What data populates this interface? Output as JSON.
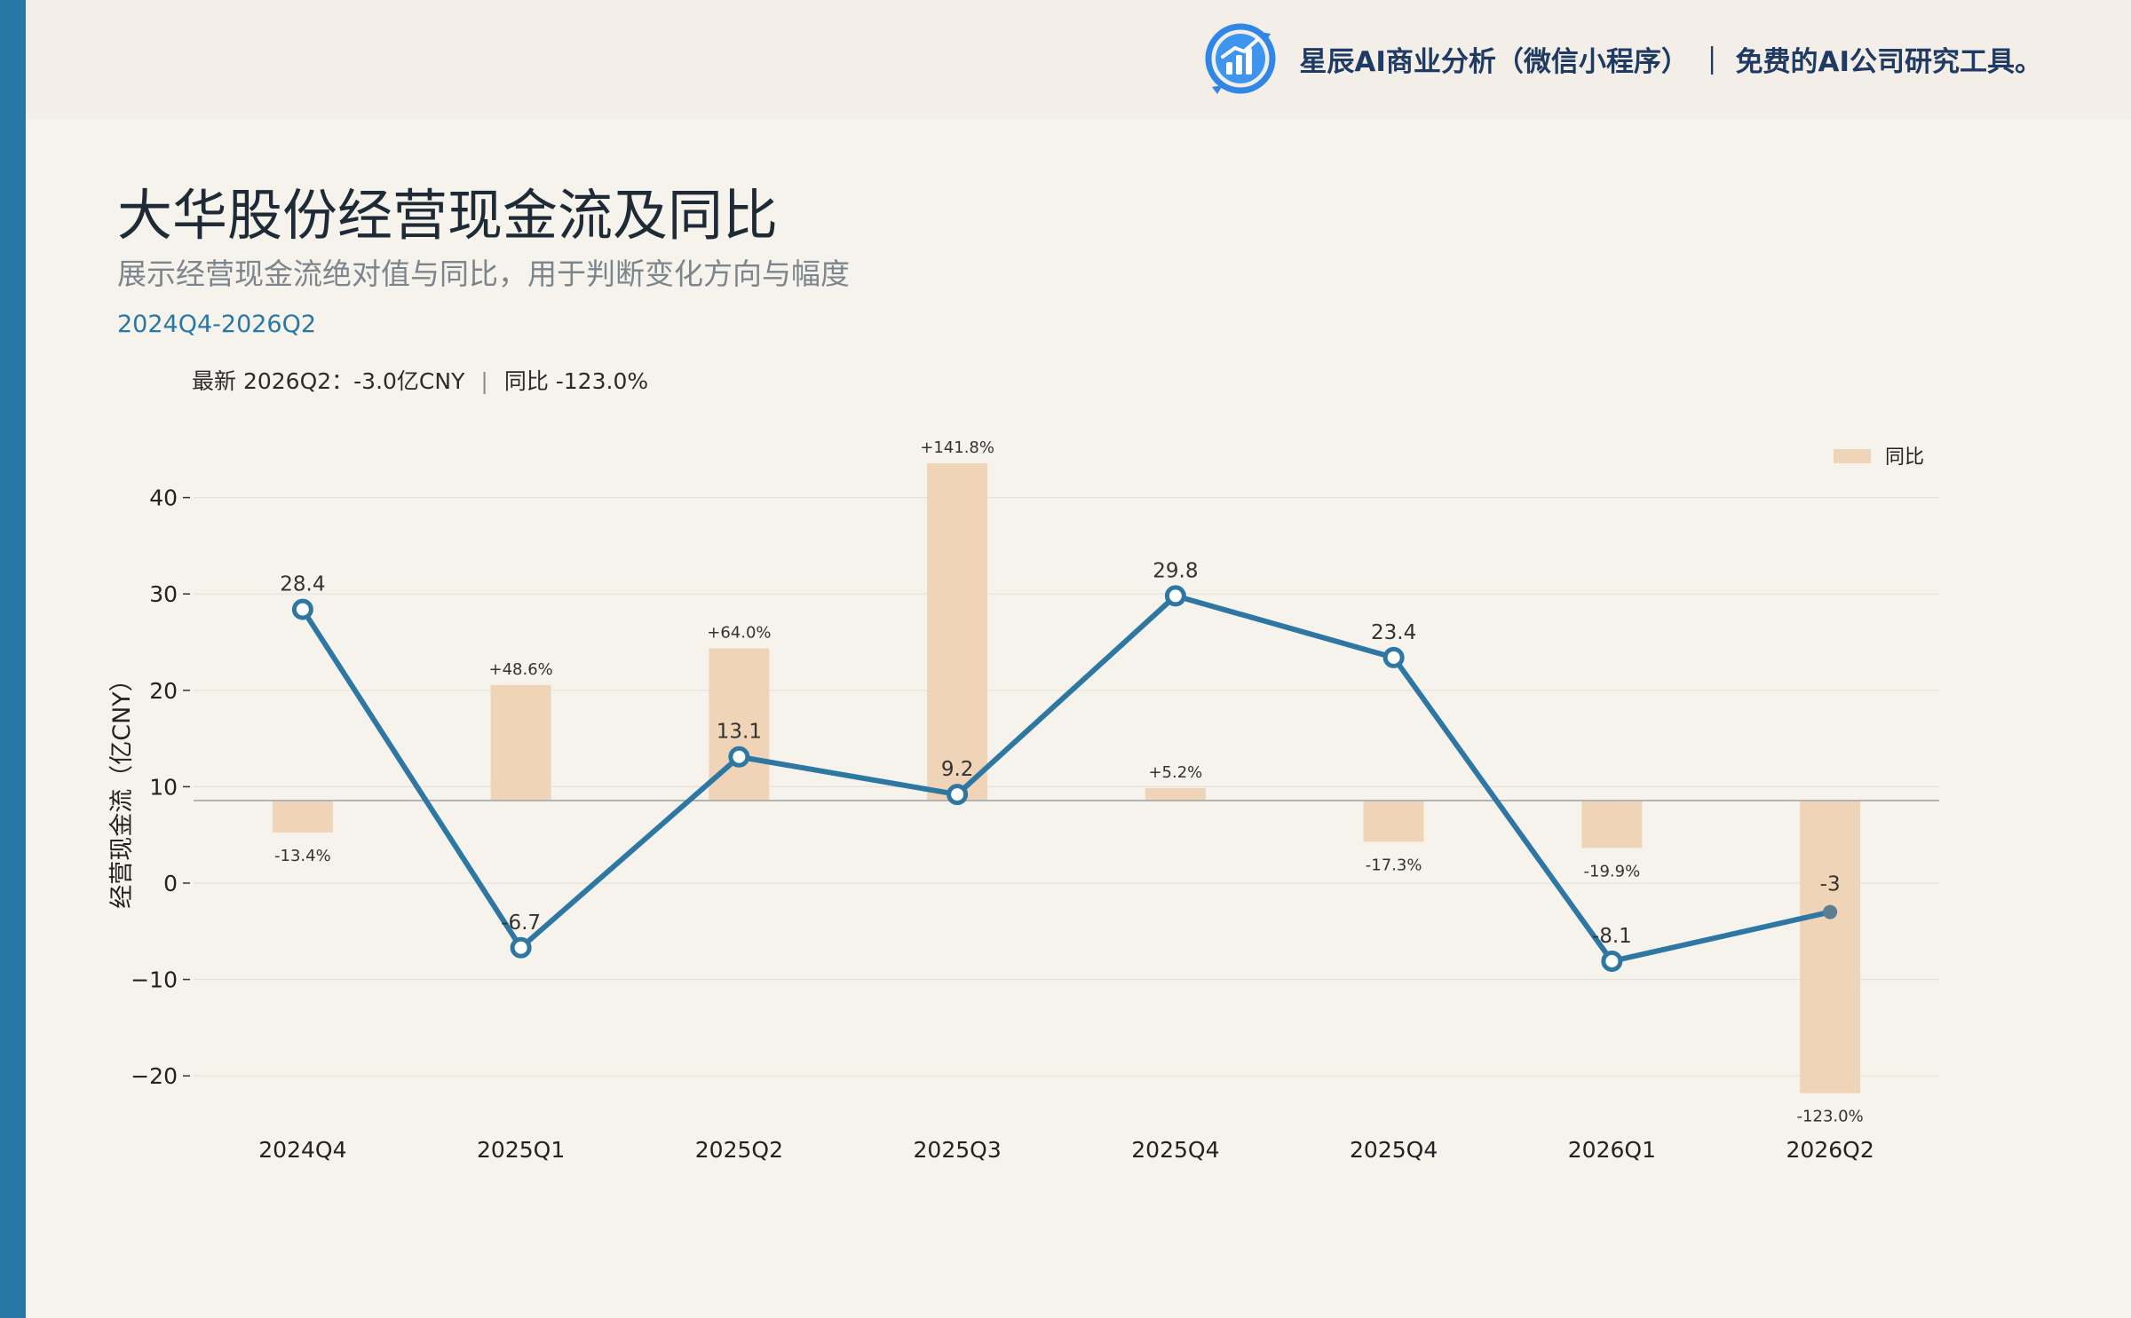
{
  "brand": {
    "logo_icon": "bar-chart-circle-logo-icon",
    "text": "星辰AI商业分析（微信小程序） ｜ 免费的AI公司研究工具。"
  },
  "header": {
    "title": "大华股份经营现金流及同比",
    "subtitle": "展示经营现金流绝对值与同比，用于判断变化方向与幅度",
    "date_range": "2024Q4-2026Q2",
    "latest_label": "最新 2026Q2：-3.0亿CNY",
    "yoy_label": "同比 -123.0%"
  },
  "colors": {
    "accent": "#2878a5",
    "line": "#2e77a3",
    "bar": "#efd4b8",
    "last_point": "#5c7d92"
  },
  "chart_data": {
    "type": "line+bar",
    "categories": [
      "2024Q4",
      "2025Q1",
      "2025Q2",
      "2025Q3",
      "2025Q4",
      "2025Q4",
      "2026Q1",
      "2026Q2"
    ],
    "ylabel": "经营现金流（亿CNY）",
    "y_ticks": [
      40,
      30,
      20,
      10,
      0,
      -10,
      -20
    ],
    "y_tick_labels": [
      "40",
      "30",
      "20",
      "10",
      "0",
      "−10",
      "−20"
    ],
    "ylim": [
      -25,
      45
    ],
    "grid": true,
    "legend": {
      "position": "top-right",
      "entries": [
        "同比"
      ]
    },
    "series": [
      {
        "kind": "line",
        "values": [
          28.4,
          -6.7,
          13.1,
          9.2,
          29.8,
          23.4,
          -8.1,
          -3.0
        ],
        "value_labels": [
          "28.4",
          "-6.7",
          "13.1",
          "9.2",
          "29.8",
          "23.4",
          "-8.1",
          "-3"
        ]
      },
      {
        "kind": "bar",
        "name": "同比",
        "unit": "%",
        "values": [
          -13.4,
          48.6,
          64.0,
          141.8,
          5.2,
          -17.3,
          -19.9,
          -123.0
        ],
        "value_labels": [
          "-13.4%",
          "+48.6%",
          "+64.0%",
          "+141.8%",
          "+5.2%",
          "-17.3%",
          "-19.9%",
          "-123.0%"
        ]
      }
    ]
  }
}
